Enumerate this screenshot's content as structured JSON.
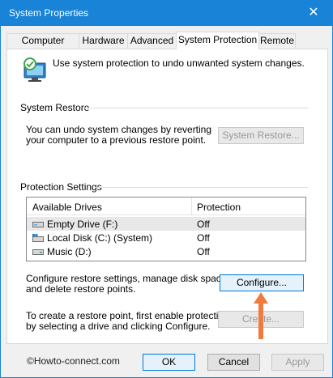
{
  "window": {
    "title": "System Properties",
    "close_glyph": "✕"
  },
  "tabs": [
    {
      "label": "Computer Name",
      "active": false
    },
    {
      "label": "Hardware",
      "active": false
    },
    {
      "label": "Advanced",
      "active": false
    },
    {
      "label": "System Protection",
      "active": true
    },
    {
      "label": "Remote",
      "active": false
    }
  ],
  "intro": {
    "icon": "system-protection-icon",
    "text": "Use system protection to undo unwanted system changes."
  },
  "system_restore": {
    "group_label": "System Restore",
    "description_line1": "You can undo system changes by reverting",
    "description_line2": "your computer to a previous restore point.",
    "button_label": "System Restore..."
  },
  "protection_settings": {
    "group_label": "Protection Settings",
    "columns": [
      "Available Drives",
      "Protection"
    ],
    "drives": [
      {
        "name": "Empty Drive (F:)",
        "protection": "Off",
        "icon": "removable-drive-icon",
        "selected": true
      },
      {
        "name": "Local Disk (C:) (System)",
        "protection": "Off",
        "icon": "system-drive-icon",
        "selected": false
      },
      {
        "name": "Music (D:)",
        "protection": "Off",
        "icon": "hard-drive-icon",
        "selected": false
      }
    ],
    "configure_text_line1": "Configure restore settings, manage disk space,",
    "configure_text_line2": "and delete restore points.",
    "configure_button": "Configure...",
    "create_text_line1": "To create a restore point, first enable protection",
    "create_text_line2": "by selecting a drive and clicking Configure.",
    "create_button": "Create..."
  },
  "footer": {
    "credit": "©Howto-connect.com",
    "ok": "OK",
    "cancel": "Cancel",
    "apply": "Apply"
  },
  "colors": {
    "titlebar": "#1883d7",
    "arrow": "#f07b3f"
  }
}
